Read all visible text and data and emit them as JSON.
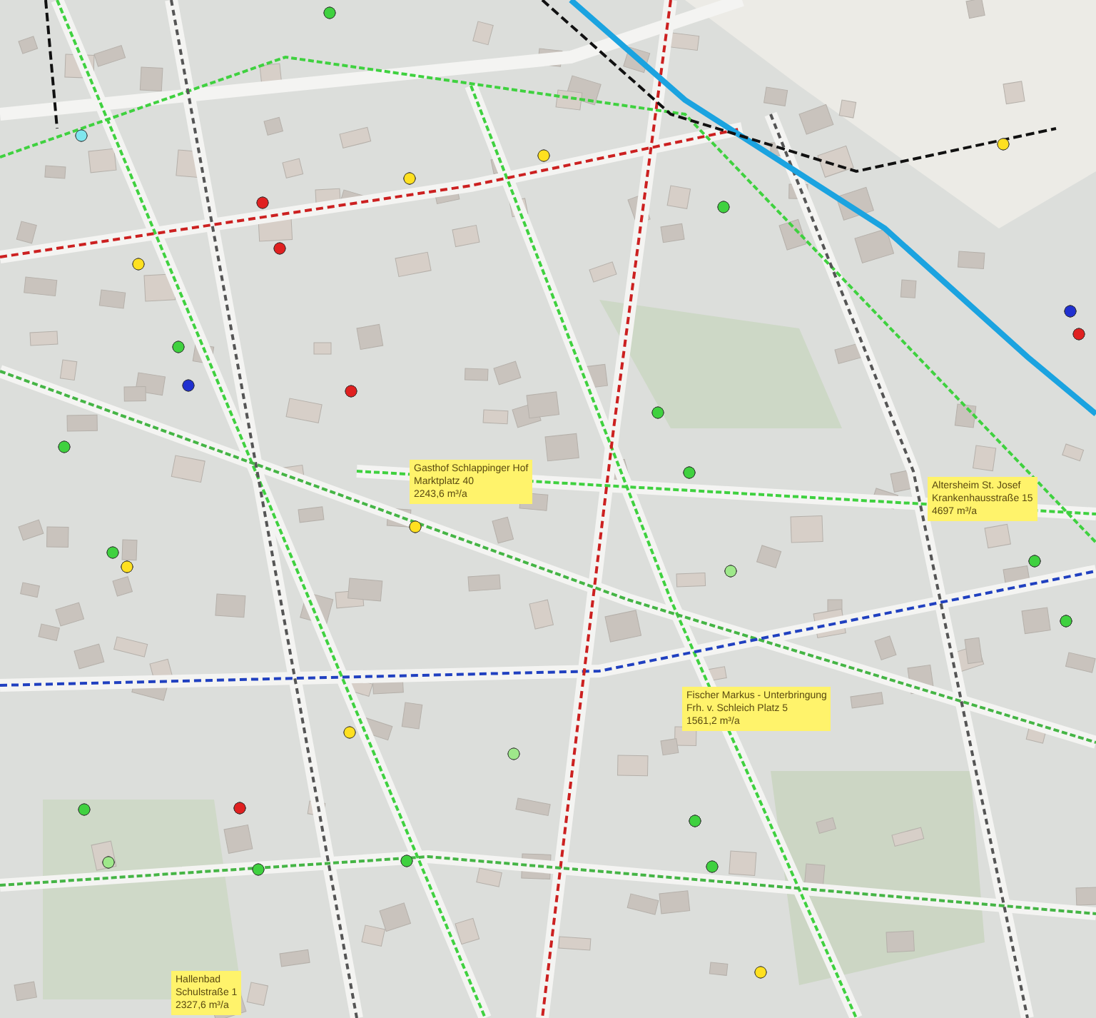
{
  "map": {
    "callouts": [
      {
        "lines": [
          "Gasthof Schlappinger Hof",
          "Marktplatz 40",
          "2243,6 m³/a"
        ]
      },
      {
        "lines": [
          "Altersheim St. Josef",
          "Krankenhausstraße 15",
          "4697 m³/a"
        ]
      },
      {
        "lines": [
          "Fischer Markus - Unterbringung",
          "Frh. v. Schleich Platz 5",
          "1561,2 m³/a"
        ]
      },
      {
        "lines": [
          "Hallenbad",
          "Schulstraße 1",
          "2327,6 m³/a"
        ]
      }
    ]
  }
}
